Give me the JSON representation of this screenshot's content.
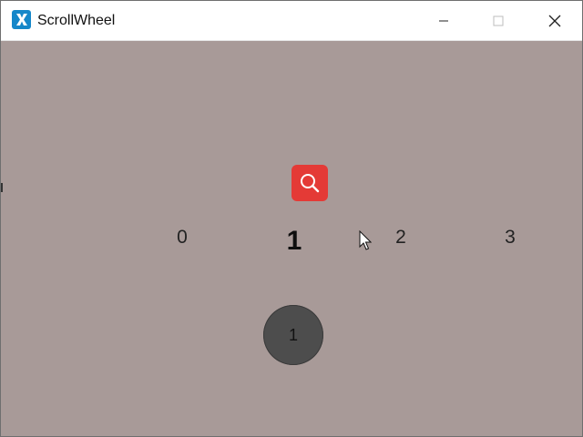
{
  "window": {
    "title": "ScrollWheel",
    "icon": "app-x-icon",
    "accent_color": "#1587c9",
    "background_color": "#a89a98"
  },
  "controls": {
    "minimize_icon": "minimize-icon",
    "maximize_icon": "maximize-icon",
    "close_icon": "close-icon"
  },
  "search_button": {
    "icon": "search-icon",
    "color": "#e43a36"
  },
  "wheel": {
    "items": [
      "0",
      "1",
      "2",
      "3"
    ],
    "selected": "1"
  },
  "indicator": {
    "value": "1"
  }
}
